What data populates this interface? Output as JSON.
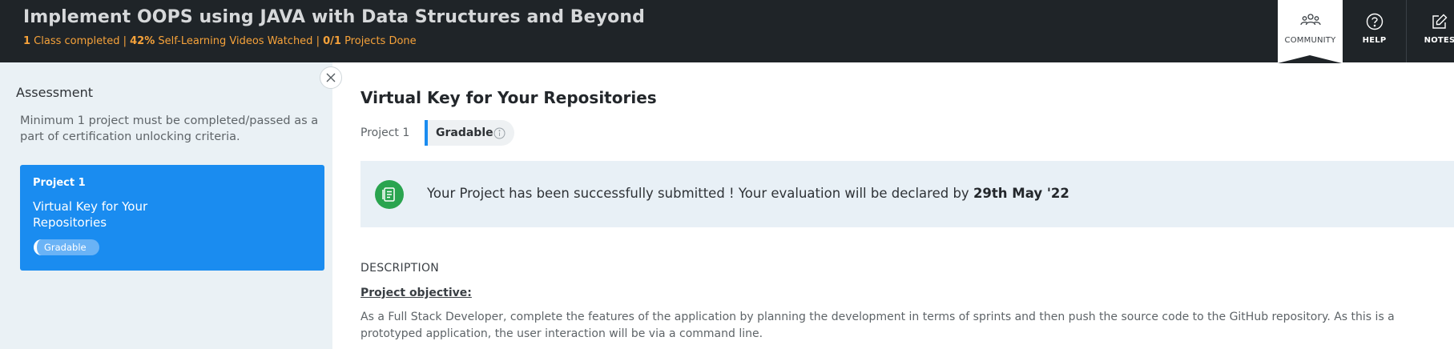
{
  "header": {
    "course_title": "Implement OOPS using JAVA with Data Structures and Beyond",
    "progress": {
      "classes_count": "1",
      "classes_text": " Class completed | ",
      "videos_percent": "42%",
      "videos_text": " Self-Learning Videos Watched  | ",
      "projects_count": "0/1",
      "projects_text": " Projects Done"
    },
    "nav": {
      "community_label": "COMMUNITY",
      "help_label": "HELP",
      "notes_label": "NOTES"
    }
  },
  "sidebar": {
    "title": "Assessment",
    "description": "Minimum 1 project must be completed/passed as a part of certification unlocking criteria.",
    "project_card": {
      "number": "Project 1",
      "title": "Virtual Key for Your Repositories",
      "badge": "Gradable"
    }
  },
  "main": {
    "title": "Virtual Key for Your Repositories",
    "project_label": "Project 1",
    "gradable_label": "Gradable",
    "success": {
      "message": "Your Project has been successfully submitted ! Your evaluation will be declared by ",
      "date": "29th May '22"
    },
    "description_heading": "DESCRIPTION",
    "objective_heading": "Project objective: ",
    "objective_text": "As a Full Stack Developer, complete the features of the application by planning the development in terms of sprints and then push the source code to the GitHub repository. As this is a prototyped application, the user interaction will be via a command line."
  },
  "colors": {
    "header_bg": "#1f2428",
    "accent_orange": "#f6a23a",
    "accent_blue": "#1a8cf0",
    "success_green": "#2aa44f",
    "sidebar_bg": "#eaf1f5"
  },
  "icons": {
    "community": "community-icon",
    "help": "help-icon",
    "notes": "notes-icon",
    "close": "close-icon",
    "info": "info-icon",
    "success": "document-check-icon"
  }
}
